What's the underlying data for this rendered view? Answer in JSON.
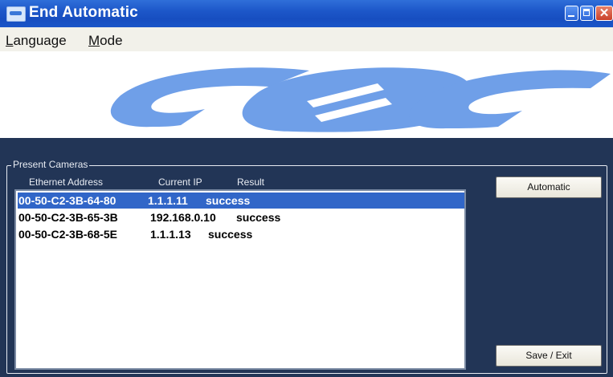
{
  "window": {
    "title": "End Automatic"
  },
  "menu": {
    "language": {
      "mnemonic": "L",
      "rest": "anguage"
    },
    "mode": {
      "mnemonic": "M",
      "rest": "ode"
    }
  },
  "logo": {
    "color": "#6f9fe8"
  },
  "present_cameras": {
    "group_title": "Present Cameras",
    "columns": [
      "Ethernet Address",
      "Current IP",
      "Result"
    ],
    "rows": [
      {
        "mac": "00-50-C2-3B-64-80",
        "ip": "1.1.1.11",
        "result": "success",
        "selected": true
      },
      {
        "mac": "00-50-C2-3B-65-3B",
        "ip": "192.168.0.10",
        "result": "success",
        "selected": false
      },
      {
        "mac": "00-50-C2-3B-68-5E",
        "ip": "1.1.1.13",
        "result": "success",
        "selected": false
      }
    ]
  },
  "buttons": {
    "automatic": "Automatic",
    "save_exit": "Save / Exit"
  },
  "colors": {
    "panel": "#223556",
    "selection": "#3166c8",
    "titlebar": "#1d57c9"
  }
}
